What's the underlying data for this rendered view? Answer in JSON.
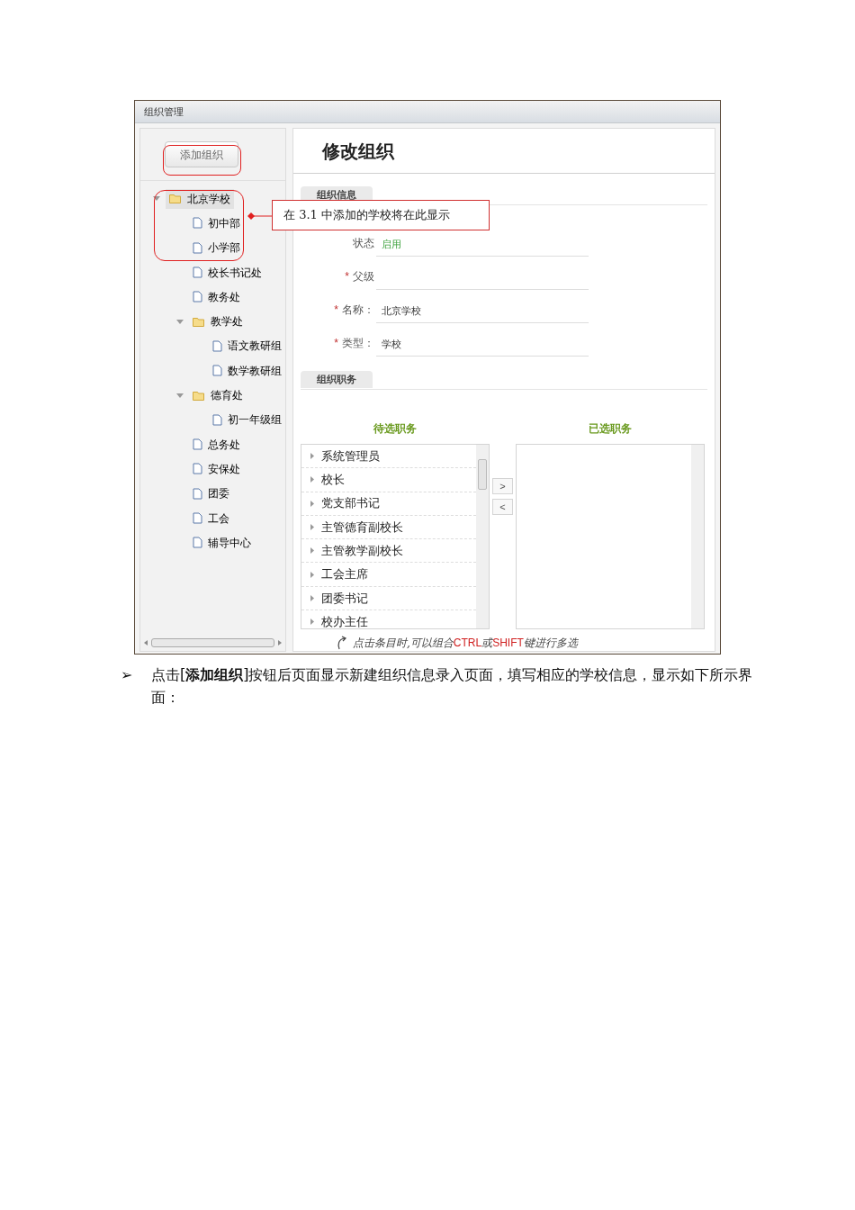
{
  "window": {
    "title": "组织管理"
  },
  "sidebar": {
    "add_button": "添加组织",
    "tree": [
      {
        "label": "北京学校",
        "kind": "folder",
        "expanded": true,
        "selected": true,
        "children": [
          {
            "label": "初中部",
            "kind": "file",
            "selected": false
          },
          {
            "label": "小学部",
            "kind": "file",
            "selected": false
          },
          {
            "label": "校长书记处",
            "kind": "file",
            "selected": false
          },
          {
            "label": "教务处",
            "kind": "file",
            "selected": false
          },
          {
            "label": "教学处",
            "kind": "folder",
            "expanded": true,
            "selected": false,
            "children": [
              {
                "label": "语文教研组",
                "kind": "file",
                "selected": false
              },
              {
                "label": "数学教研组",
                "kind": "file",
                "selected": false
              }
            ]
          },
          {
            "label": "德育处",
            "kind": "folder",
            "expanded": true,
            "selected": false,
            "children": [
              {
                "label": "初一年级组",
                "kind": "file",
                "selected": false
              }
            ]
          },
          {
            "label": "总务处",
            "kind": "file",
            "selected": false
          },
          {
            "label": "安保处",
            "kind": "file",
            "selected": false
          },
          {
            "label": "团委",
            "kind": "file",
            "selected": false
          },
          {
            "label": "工会",
            "kind": "file",
            "selected": false
          },
          {
            "label": "辅导中心",
            "kind": "file",
            "selected": false
          }
        ]
      }
    ]
  },
  "main": {
    "title": "修改组织",
    "info_section": "组织信息",
    "fields": [
      {
        "label": "状态",
        "value": "启用",
        "kind": "status"
      },
      {
        "label": "父级",
        "required_mark": "*",
        "kind": "plain"
      },
      {
        "label": "名称：",
        "value": "北京学校",
        "required_mark": "*",
        "kind": "plain"
      },
      {
        "label": "类型：",
        "value": "学校",
        "required_mark": "*",
        "kind": "plain"
      }
    ],
    "duty_section": "组织职务",
    "available_header": "待选职务",
    "selected_header": "已选职务",
    "available": [
      "系统管理员",
      "校长",
      "党支部书记",
      "主管德育副校长",
      "主管教学副校长",
      "工会主席",
      "团委书记",
      "校办主任"
    ],
    "move_right": ">",
    "move_left": "<",
    "hint": [
      {
        "text": "点击条目时,可以组合",
        "highlight": false
      },
      {
        "text": "CTRL",
        "highlight": true
      },
      {
        "text": "或",
        "highlight": false
      },
      {
        "text": "SHIFT",
        "highlight": true
      },
      {
        "text": "键进行多选",
        "highlight": false
      }
    ]
  },
  "callout": "在 3.1 中添加的学校将在此显示",
  "paragraph": {
    "bullet": "➢",
    "text": "点击[**添加组织**]按钮后页面显示新建组织信息录入页面，填写相应的学校信息，显示如下所示界面："
  }
}
